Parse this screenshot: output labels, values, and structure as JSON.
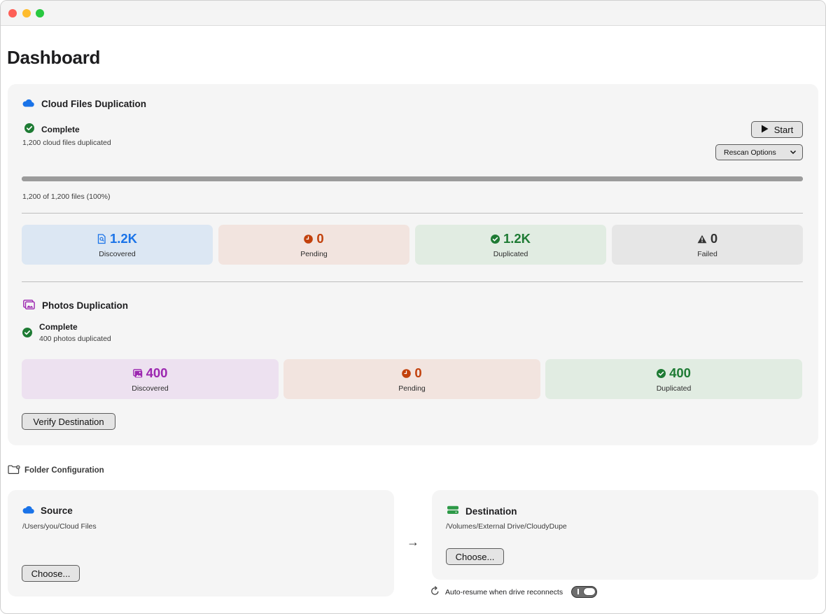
{
  "page": {
    "title": "Dashboard"
  },
  "cloud": {
    "title": "Cloud Files Duplication",
    "status": "Complete",
    "summary": "1,200 cloud files duplicated",
    "start_label": "Start",
    "rescan_label": "Rescan Options",
    "progress_text": "1,200 of 1,200 files (100%)",
    "progress_fraction": 1.0,
    "stats": [
      {
        "value": "1.2K",
        "label": "Discovered",
        "icon": "document-search-icon",
        "color": "#1a73e8",
        "bg": "#dce7f3"
      },
      {
        "value": "0",
        "label": "Pending",
        "icon": "clock-icon",
        "color": "#c2410c",
        "bg": "#f2e4df"
      },
      {
        "value": "1.2K",
        "label": "Duplicated",
        "icon": "checkmark-circle-icon",
        "color": "#1e7b34",
        "bg": "#e1ece2"
      },
      {
        "value": "0",
        "label": "Failed",
        "icon": "warning-triangle-icon",
        "color": "#333333",
        "bg": "#e6e6e6"
      }
    ]
  },
  "photos": {
    "title": "Photos Duplication",
    "status": "Complete",
    "summary": "400 photos duplicated",
    "stats": [
      {
        "value": "400",
        "label": "Discovered",
        "icon": "photo-icon",
        "color": "#9c27b0",
        "bg": "#ede1f0"
      },
      {
        "value": "0",
        "label": "Pending",
        "icon": "clock-icon",
        "color": "#c2410c",
        "bg": "#f2e4df"
      },
      {
        "value": "400",
        "label": "Duplicated",
        "icon": "checkmark-circle-icon",
        "color": "#1e7b34",
        "bg": "#e1ece2"
      }
    ],
    "verify_label": "Verify Destination"
  },
  "folders": {
    "heading": "Folder Configuration",
    "source": {
      "title": "Source",
      "path": "/Users/you/Cloud Files",
      "choose_label": "Choose..."
    },
    "destination": {
      "title": "Destination",
      "path": "/Volumes/External Drive/CloudyDupe",
      "choose_label": "Choose..."
    },
    "arrow": "→",
    "auto_resume_label": "Auto-resume when drive reconnects",
    "auto_resume_on": true
  },
  "colors": {
    "accent_blue": "#1a73e8",
    "success_green": "#1e7b34",
    "pending_orange": "#c2410c",
    "photo_purple": "#9c27b0",
    "drive_green": "#2e9a48"
  }
}
